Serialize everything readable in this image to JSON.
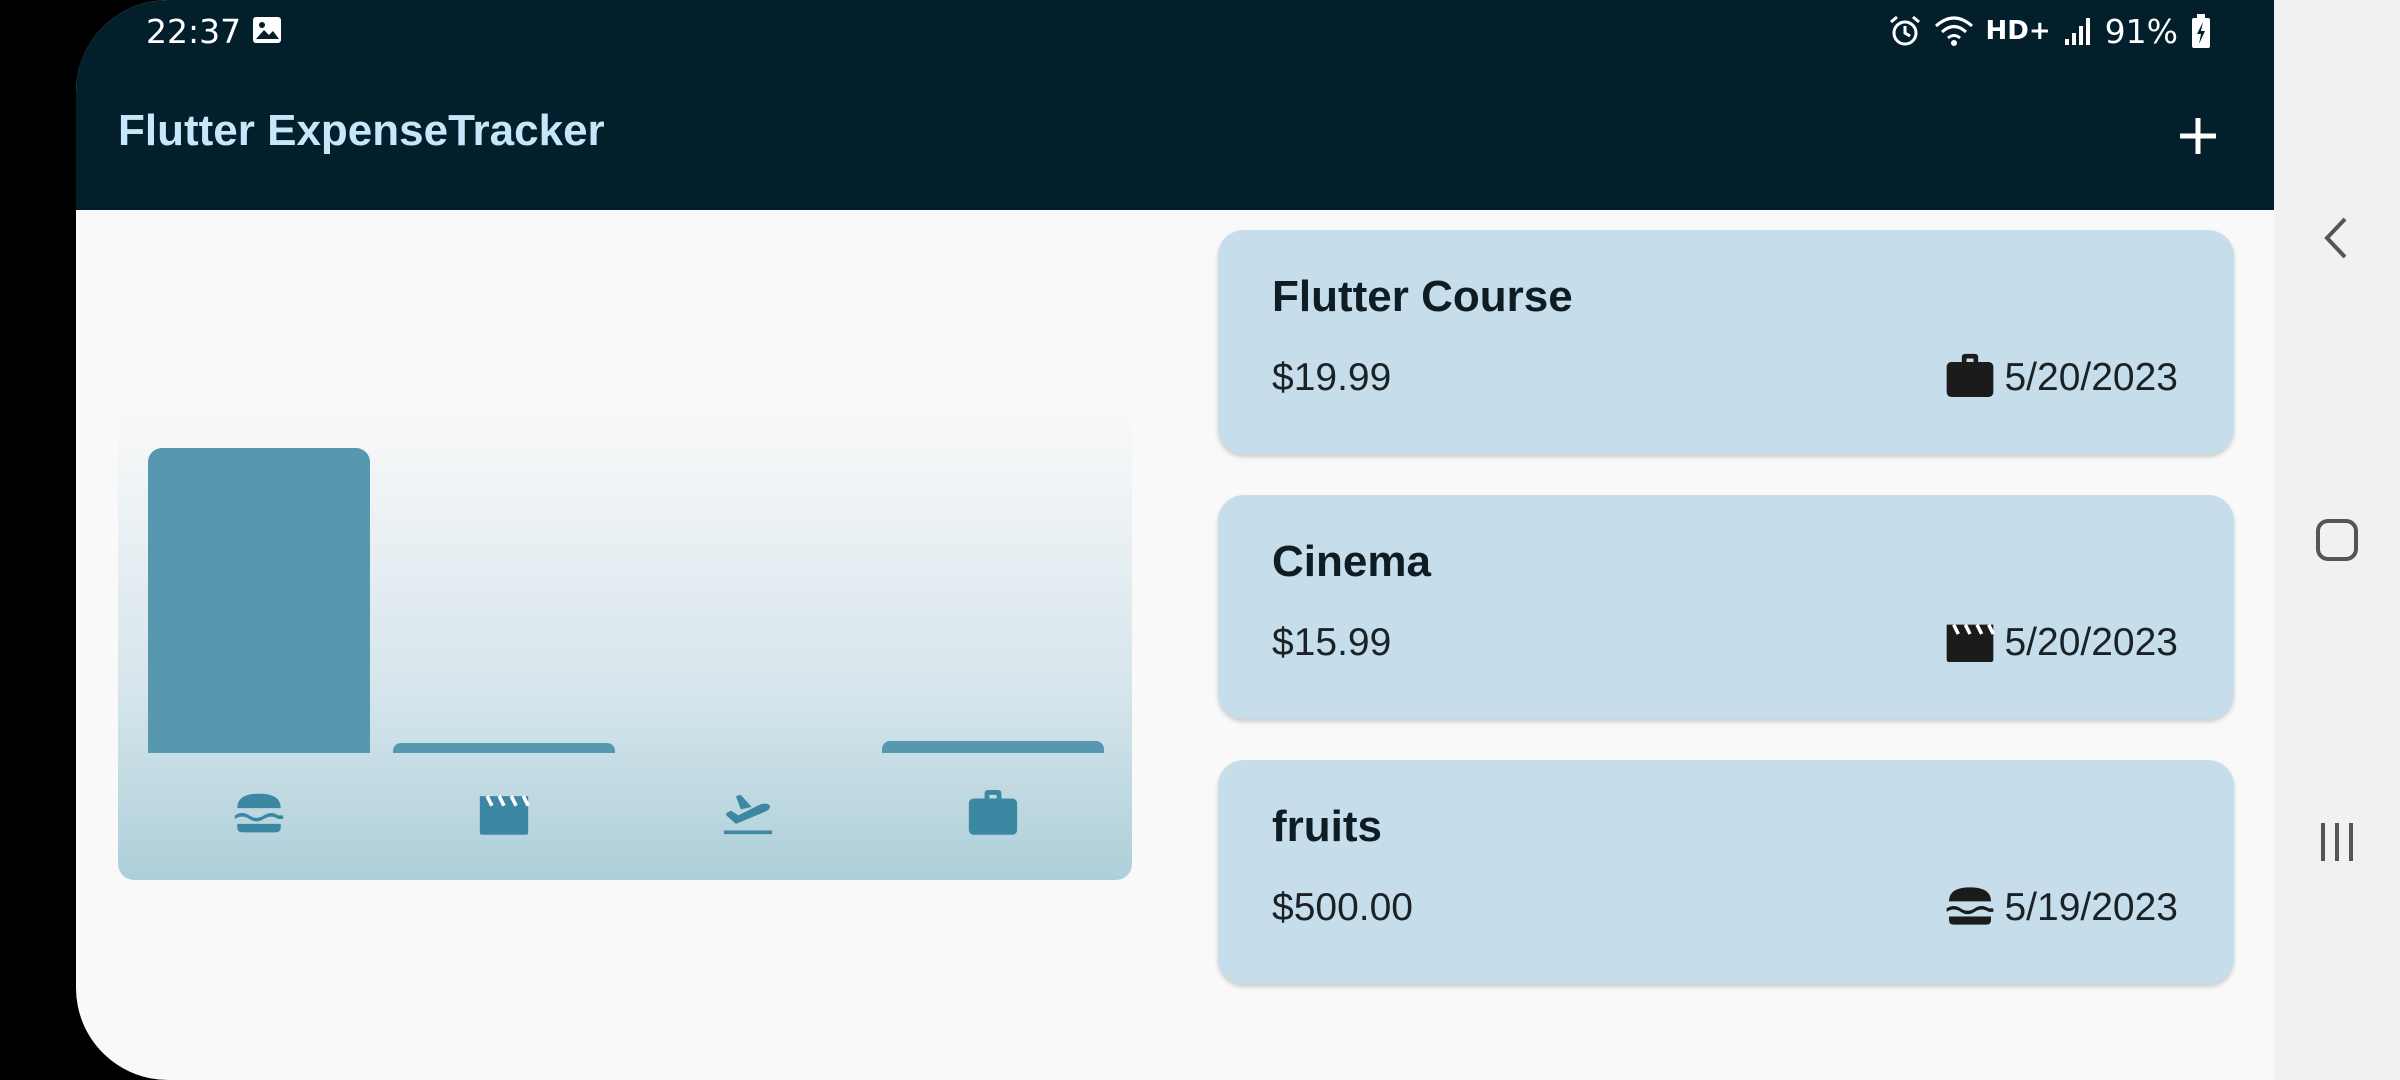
{
  "status_bar": {
    "time": "22:37",
    "network": "HD+",
    "battery": "91%"
  },
  "app_bar": {
    "title": "Flutter ExpenseTracker",
    "add_icon": "plus-icon"
  },
  "chart": {
    "categories": [
      {
        "icon": "burger-icon",
        "fill": 1.0
      },
      {
        "icon": "clapperboard-icon",
        "fill": 0.032
      },
      {
        "icon": "flight-takeoff-icon",
        "fill": 0.0
      },
      {
        "icon": "briefcase-icon",
        "fill": 0.04
      }
    ],
    "bar_color": "#5798b0",
    "icon_color": "#3c88a3"
  },
  "expenses": [
    {
      "title": "Flutter Course",
      "amount": "$19.99",
      "date": "5/20/2023",
      "icon": "briefcase-icon"
    },
    {
      "title": "Cinema",
      "amount": "$15.99",
      "date": "5/20/2023",
      "icon": "clapperboard-icon"
    },
    {
      "title": "fruits",
      "amount": "$500.00",
      "date": "5/19/2023",
      "icon": "burger-icon"
    }
  ],
  "colors": {
    "app_bar": "#021f2b",
    "title": "#c5e7f9",
    "card": "#c6deeb",
    "background": "#f9f9f9"
  }
}
